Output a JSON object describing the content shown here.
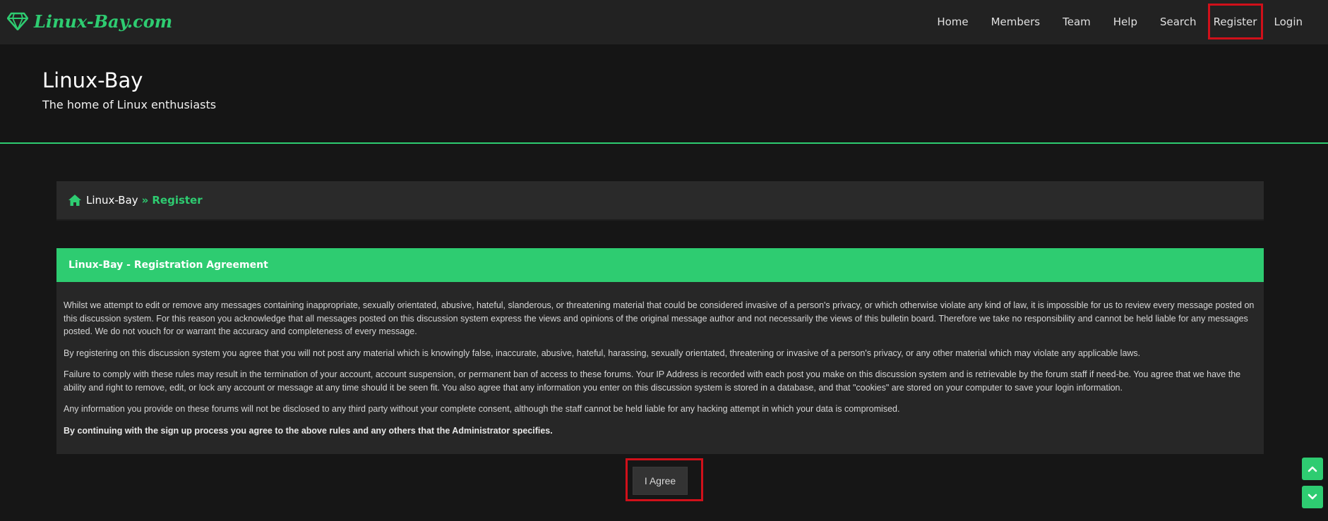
{
  "brand": {
    "logo_text": "Linux-Bay.com",
    "accent": "#2ecc71",
    "icon": "diamond-icon"
  },
  "nav": {
    "items": [
      {
        "label": "Home"
      },
      {
        "label": "Members"
      },
      {
        "label": "Team"
      },
      {
        "label": "Help"
      },
      {
        "label": "Search"
      },
      {
        "label": "Register"
      },
      {
        "label": "Login"
      }
    ],
    "highlight_color": "#d0101a"
  },
  "header": {
    "title": "Linux-Bay",
    "description": "The home of Linux enthusiasts"
  },
  "breadcrumb": {
    "home_icon": "home-icon",
    "home_label": "Linux-Bay",
    "separator": "»",
    "current": "Register"
  },
  "agreement": {
    "heading": "Linux-Bay - Registration Agreement",
    "paragraphs": [
      "Whilst we attempt to edit or remove any messages containing inappropriate, sexually orientated, abusive, hateful, slanderous, or threatening material that could be considered invasive of a person's privacy, or which otherwise violate any kind of law, it is impossible for us to review every message posted on this discussion system. For this reason you acknowledge that all messages posted on this discussion system express the views and opinions of the original message author and not necessarily the views of this bulletin board. Therefore we take no responsibility and cannot be held liable for any messages posted. We do not vouch for or warrant the accuracy and completeness of every message.",
      "By registering on this discussion system you agree that you will not post any material which is knowingly false, inaccurate, abusive, hateful, harassing, sexually orientated, threatening or invasive of a person's privacy, or any other material which may violate any applicable laws.",
      "Failure to comply with these rules may result in the termination of your account, account suspension, or permanent ban of access to these forums. Your IP Address is recorded with each post you make on this discussion system and is retrievable by the forum staff if need-be. You agree that we have the ability and right to remove, edit, or lock any account or message at any time should it be seen fit. You also agree that any information you enter on this discussion system is stored in a database, and that \"cookies\" are stored on your computer to save your login information.",
      "Any information you provide on these forums will not be disclosed to any third party without your complete consent, although the staff cannot be held liable for any hacking attempt in which your data is compromised."
    ],
    "closing": "By continuing with the sign up process you agree to the above rules and any others that the Administrator specifies.",
    "agree_label": "I Agree"
  },
  "scroll": {
    "up_icon": "chevron-up-icon",
    "down_icon": "chevron-down-icon"
  }
}
